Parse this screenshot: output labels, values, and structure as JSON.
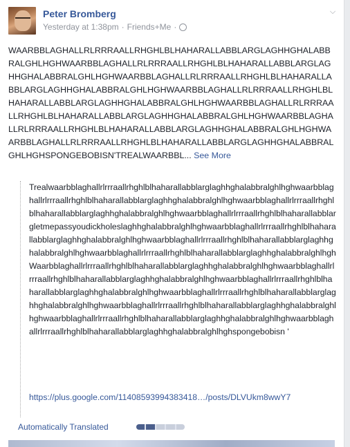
{
  "post": {
    "author": "Peter Bromberg",
    "timestamp": "Yesterday at 1:38pm",
    "separator": "·",
    "audience": "Friends+Me",
    "text": "WAARBBLAGHALLRLRRRAALLRHGHLBLHAHARALLABBLARGLAGHHGHALABBRALGHLHGHWAARBBLAGHALLRLRRRAALLRHGHLBLHAHARALLABBLARGLAGHHGHALABBRALGHLHGHWAARBBLAGHALLRLRRRAALLRHGHLBLHAHARALLABBLARGLAGHHGHALABBRALGHLHGHWAARBBLAGHALLRLRRRAALLRHGHLBLHAHARALLABBLARGLAGHHGHALABBRALGHLHGHWAARBBLAGHALLRLRRRAALLRHGHLBLHAHARALLABBLARGLAGHHGHALABBRALGHLHGHWAARBBLAGHALLRLRRRAALLRHGHLBLHAHARALLABBLARGLAGHHGHALABBRALGHLHGHWAARBBLAGHALLRLRRRAALLRHGHLBLHAHARALLABBLARGLAGHHGHALABBRALGHLHGHSPONGEBOBISN'TREALWAARBBL...",
    "see_more": "See More"
  },
  "shared": {
    "text": "Trealwaarbblaghallrlrrraallrhghlblhaharallabblarglaghhghalabbralghlhghwaarbblaghallrlrrraallrhghlblhaharallabblarglaghhghalabbralghlhghwaarbblaghallrlrrraallrhghlblhaharallabblarglaghhghalabbralghlhghwaarbblaghallrlrrraallrhghlblhaharallabblargletmepassyoudickholeslaghhghalabbralghlhghwaarbblaghallrlrrraallrhghlblhaharallabblarglaghhghalabbralghlhghwaarbblaghallrlrrraallrhghlblhaharallabblarglaghhghalabbralghlhghwaarbblaghallrlrrraallrhghlblhaharallabblarglaghhghalabbralghlhgh Waarbblaghallrlrrraallrhghlblhaharallabblarglaghhghalabbralghlhghwaarbblaghallrlrrraallrhghlblhaharallabblarglaghhghalabbralghlhghwaarbblaghallrlrrraallrhghlblhaharallabblarglaghhghalabbralghlhghwaarbblaghallrlrrraallrhghlblhaharallabblarglaghhghalabbralghlhghwaarbblaghallrlrrraallrhghlblhaharallabblarglaghhghalabbralghlhghwaarbblaghallrlrrraallrhghlblhaharallabblarglaghhghalabbralghlhghwaarbblaghallrlrrraallrhghlblhaharallabblarglaghhghalabbralghlhghspongebobisn '",
    "link": "https://plus.google.com/114085939943834​18…/posts/DLVUkm8wwY7"
  },
  "translation": {
    "label": "Automatically Translated",
    "quality": 0.4
  },
  "colors": {
    "link": "#365899",
    "meta": "#90949c",
    "body": "#1d2129"
  }
}
